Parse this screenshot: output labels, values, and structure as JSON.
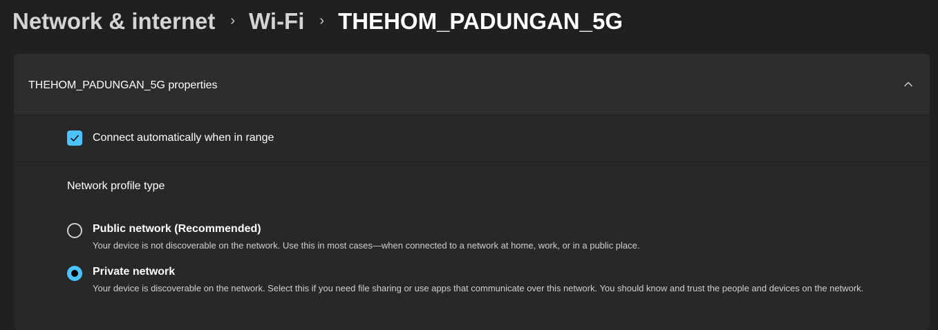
{
  "breadcrumb": {
    "items": [
      "Network & internet",
      "Wi-Fi",
      "THEHOM_PADUNGAN_5G"
    ],
    "separator": "›"
  },
  "panel": {
    "title": "THEHOM_PADUNGAN_5G properties",
    "expanded": true,
    "connect_auto": {
      "label": "Connect automatically when in range",
      "checked": true
    },
    "profile": {
      "label": "Network profile type",
      "options": [
        {
          "title": "Public network (Recommended)",
          "description": "Your device is not discoverable on the network. Use this in most cases—when connected to a network at home, work, or in a public place.",
          "selected": false
        },
        {
          "title": "Private network",
          "description": "Your device is discoverable on the network. Select this if you need file sharing or use apps that communicate over this network. You should know and trust the people and devices on the network.",
          "selected": true
        }
      ]
    }
  },
  "colors": {
    "accent": "#4cc2ff",
    "background": "#202020",
    "card": "#2b2b2b",
    "text_secondary": "#cfcfcf"
  },
  "icons": {
    "expander": "chevron-up-icon",
    "checkbox": "checkmark-icon"
  }
}
